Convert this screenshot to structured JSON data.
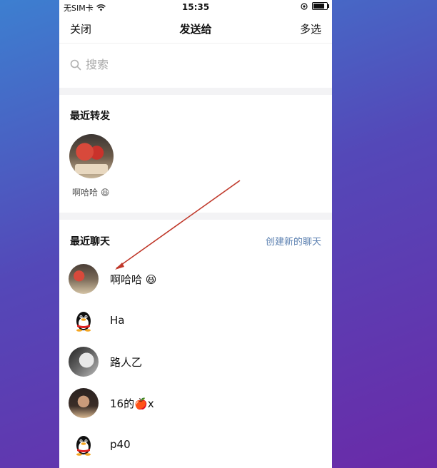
{
  "status_bar": {
    "carrier": "无SIM卡",
    "time": "15:35"
  },
  "nav": {
    "close_label": "关闭",
    "title": "发送给",
    "multiselect_label": "多选"
  },
  "search": {
    "placeholder": "搜索"
  },
  "recent_forward": {
    "title": "最近转发",
    "items": [
      {
        "name": "啊哈哈 😆"
      }
    ]
  },
  "recent_chat": {
    "title": "最近聊天",
    "create_label": "创建新的聊天",
    "items": [
      {
        "name": "啊哈哈 😆",
        "avatar": "photo-avatar"
      },
      {
        "name": "Ha",
        "avatar": "penguin-avatar"
      },
      {
        "name": "路人乙",
        "avatar": "bw-photo-avatar"
      },
      {
        "name": "16的🍎x",
        "avatar": "girl-photo-avatar"
      },
      {
        "name": "p40",
        "avatar": "penguin-avatar"
      }
    ]
  },
  "colors": {
    "link": "#5a7fb0",
    "annotation_arrow": "#c0392b"
  }
}
